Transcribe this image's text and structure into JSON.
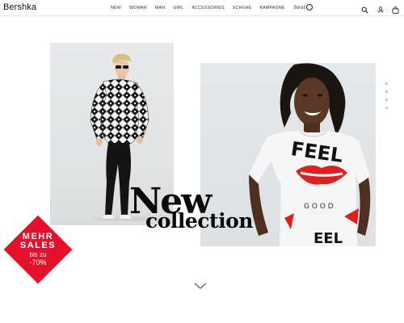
{
  "header": {
    "logo": "Bershka",
    "nav": [
      {
        "label": "NEW"
      },
      {
        "label": "WOMAN"
      },
      {
        "label": "MAN"
      },
      {
        "label": "GIRL"
      },
      {
        "label": "ACCESSORIES"
      },
      {
        "label": "SCHUHE"
      },
      {
        "label": "KAMPAGNE"
      }
    ],
    "brand_link": "beat",
    "login_label": "Login",
    "icons": [
      "search-icon",
      "user-icon",
      "shopping-bag-icon"
    ]
  },
  "hero": {
    "heading_line1": "New",
    "heading_line2": "collection",
    "photo_left": "man-in-patterned-sweater-photo",
    "photo_right": "woman-in-feel-good-tshirt-photo",
    "tshirt_text": [
      "FEEL",
      "GOOD"
    ]
  },
  "sales_badge": {
    "line1": "MEHR",
    "line2": "SALES",
    "line3": "bis zu",
    "line4": "-70%",
    "color": "#e3112b"
  },
  "scroll_icon": "chevron-down-icon",
  "side_dots_color": "#e8a7a7"
}
